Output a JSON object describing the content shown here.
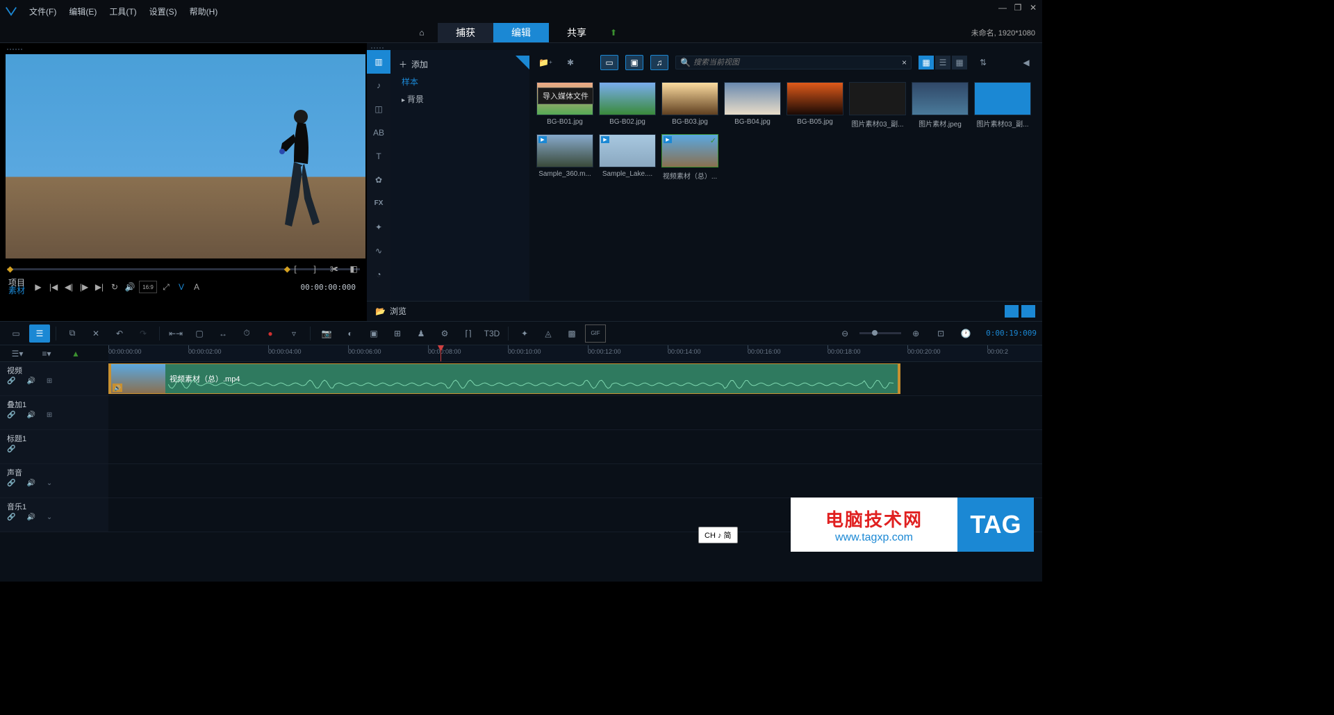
{
  "menu": {
    "file": "文件(F)",
    "edit": "编辑(E)",
    "tools": "工具(T)",
    "settings": "设置(S)",
    "help": "帮助(H)"
  },
  "modes": {
    "capture": "捕获",
    "edit": "编辑",
    "share": "共享"
  },
  "project_info": "未命名, 1920*1080",
  "preview": {
    "tab_project": "项目",
    "tab_source": "素材",
    "aspect": "16:9",
    "v": "V",
    "a": "A",
    "timecode": "00:00:00:000"
  },
  "library": {
    "add": "添加",
    "tree_sample": "样本",
    "tree_bg": "背景",
    "search_placeholder": "搜索当前视图",
    "tooltip": "导入媒体文件",
    "browse": "浏览",
    "fx": "FX",
    "thumbs": [
      {
        "label": "BG-B01.jpg",
        "bg": "linear-gradient(#f0aa88,#55aa55)"
      },
      {
        "label": "BG-B02.jpg",
        "bg": "linear-gradient(#7aadee,#3a8a3a)"
      },
      {
        "label": "BG-B03.jpg",
        "bg": "linear-gradient(#fcdca0,#604020)"
      },
      {
        "label": "BG-B04.jpg",
        "bg": "linear-gradient(#6a8aaf,#e8dcc8)"
      },
      {
        "label": "BG-B05.jpg",
        "bg": "linear-gradient(#e05a1a,#1a0a05)"
      },
      {
        "label": "图片素材03_副...",
        "bg": "#1a1a1a"
      },
      {
        "label": "图片素材.jpeg",
        "bg": "linear-gradient(#304868,#4a7a9a)"
      },
      {
        "label": "图片素材03_副...",
        "bg": "#1b88d4"
      },
      {
        "label": "Sample_360.m...",
        "bg": "linear-gradient(#88aacc,#3a4a3a)",
        "vid": true
      },
      {
        "label": "Sample_Lake....",
        "bg": "linear-gradient(#a8c8e0,#8aa8c0)",
        "vid": true
      },
      {
        "label": "视频素材（总）...",
        "bg": "linear-gradient(#5aa8e0,#8a7050)",
        "vid": true,
        "sel": true
      }
    ]
  },
  "timeline": {
    "t3d": "T3D",
    "clock": "0:00:19:009",
    "ruler": [
      "00:00:00:00",
      "00:00:02:00",
      "00:00:04:00",
      "00:00:06:00",
      "00:00:08:00",
      "00:00:10:00",
      "00:00:12:00",
      "00:00:14:00",
      "00:00:16:00",
      "00:00:18:00",
      "00:00:20:00",
      "00:00:2"
    ],
    "tracks": [
      {
        "name": "视频",
        "icons": 3
      },
      {
        "name": "叠加1",
        "icons": 3
      },
      {
        "name": "标题1",
        "icons": 1
      },
      {
        "name": "声音",
        "icons": 2
      },
      {
        "name": "音乐1",
        "icons": 2
      }
    ],
    "clip_label": "视频素材（总）.mp4"
  },
  "ime": "CH ♪ 简",
  "watermark": {
    "line1": "电脑技术网",
    "line2": "www.tagxp.com",
    "tag": "TAG"
  }
}
